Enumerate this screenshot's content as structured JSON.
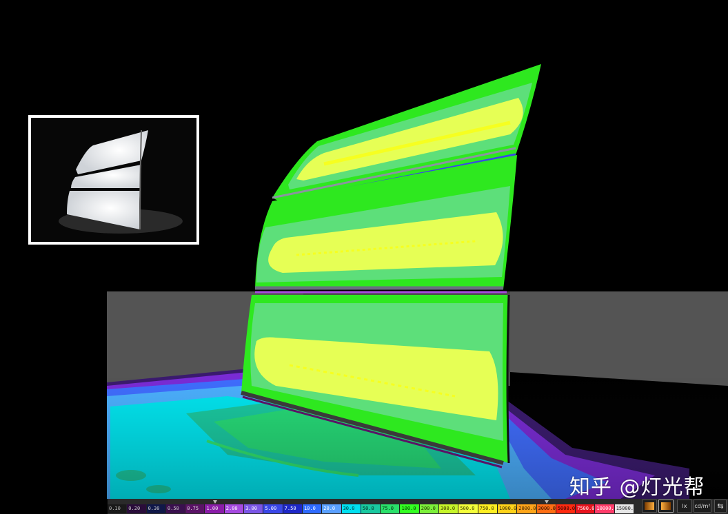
{
  "watermark": "知乎 @灯光帮",
  "legend": {
    "entries": [
      {
        "label": "0.10",
        "color": "#1a1a1a",
        "text": "#bbbbbb"
      },
      {
        "label": "0.20",
        "color": "#2a0d3a",
        "text": "#cccccc"
      },
      {
        "label": "0.30",
        "color": "#101848",
        "text": "#cccccc"
      },
      {
        "label": "0.50",
        "color": "#3a104e",
        "text": "#cccccc"
      },
      {
        "label": "0.75",
        "color": "#5a1366",
        "text": "#dddddd"
      },
      {
        "label": "1.00",
        "color": "#8a1ca8",
        "text": "#eeeeee"
      },
      {
        "label": "2.00",
        "color": "#a64ae0",
        "text": "#ffffff"
      },
      {
        "label": "3.00",
        "color": "#7b56e6",
        "text": "#ffffff"
      },
      {
        "label": "5.00",
        "color": "#3a47e8",
        "text": "#ffffff"
      },
      {
        "label": "7.50",
        "color": "#1e28c8",
        "text": "#ffffff"
      },
      {
        "label": "10.0",
        "color": "#2f6bff",
        "text": "#ffffff"
      },
      {
        "label": "20.0",
        "color": "#5aa0ff",
        "text": "#ffffff"
      },
      {
        "label": "30.0",
        "color": "#00e0f0",
        "text": "#003333"
      },
      {
        "label": "50.0",
        "color": "#19c9a0",
        "text": "#002a20"
      },
      {
        "label": "75.0",
        "color": "#2ae06a",
        "text": "#002a10"
      },
      {
        "label": "100.0",
        "color": "#33ff22",
        "text": "#003300"
      },
      {
        "label": "200.0",
        "color": "#7cf03a",
        "text": "#223300"
      },
      {
        "label": "300.0",
        "color": "#c6f52a",
        "text": "#333300"
      },
      {
        "label": "500.0",
        "color": "#f4ff3a",
        "text": "#333300"
      },
      {
        "label": "750.0",
        "color": "#ffee22",
        "text": "#333300"
      },
      {
        "label": "1000.0",
        "color": "#ffd21a",
        "text": "#332200"
      },
      {
        "label": "2000.0",
        "color": "#ffa51a",
        "text": "#331a00"
      },
      {
        "label": "3000.0",
        "color": "#ff6e14",
        "text": "#220800"
      },
      {
        "label": "5000.0",
        "color": "#ff2a10",
        "text": "#220000"
      },
      {
        "label": "7500.0",
        "color": "#e8141e",
        "text": "#ffffff"
      },
      {
        "label": "10000.0",
        "color": "#ff3c6a",
        "text": "#ffffff"
      },
      {
        "label": "15000.0",
        "color": "#e6e6e6",
        "text": "#222222"
      }
    ],
    "markers": [
      {
        "label": "1.00"
      },
      {
        "label": "3000.0"
      }
    ]
  },
  "toolbar": {
    "lux_label": "lx",
    "luminance_label": "cd/m²",
    "gradient_icon": "gradient-icon",
    "gradient_alt_icon": "gradient-alt-icon",
    "swap_icon": "swap-arrows-icon"
  },
  "colors": {
    "background": "#000000",
    "floor_grey": "#555555",
    "wall_green": "#2ee81f",
    "band_light_green": "#5ddf7a",
    "band_yellow": "#e6ff55",
    "floor_cyan": "#00e6f0"
  }
}
